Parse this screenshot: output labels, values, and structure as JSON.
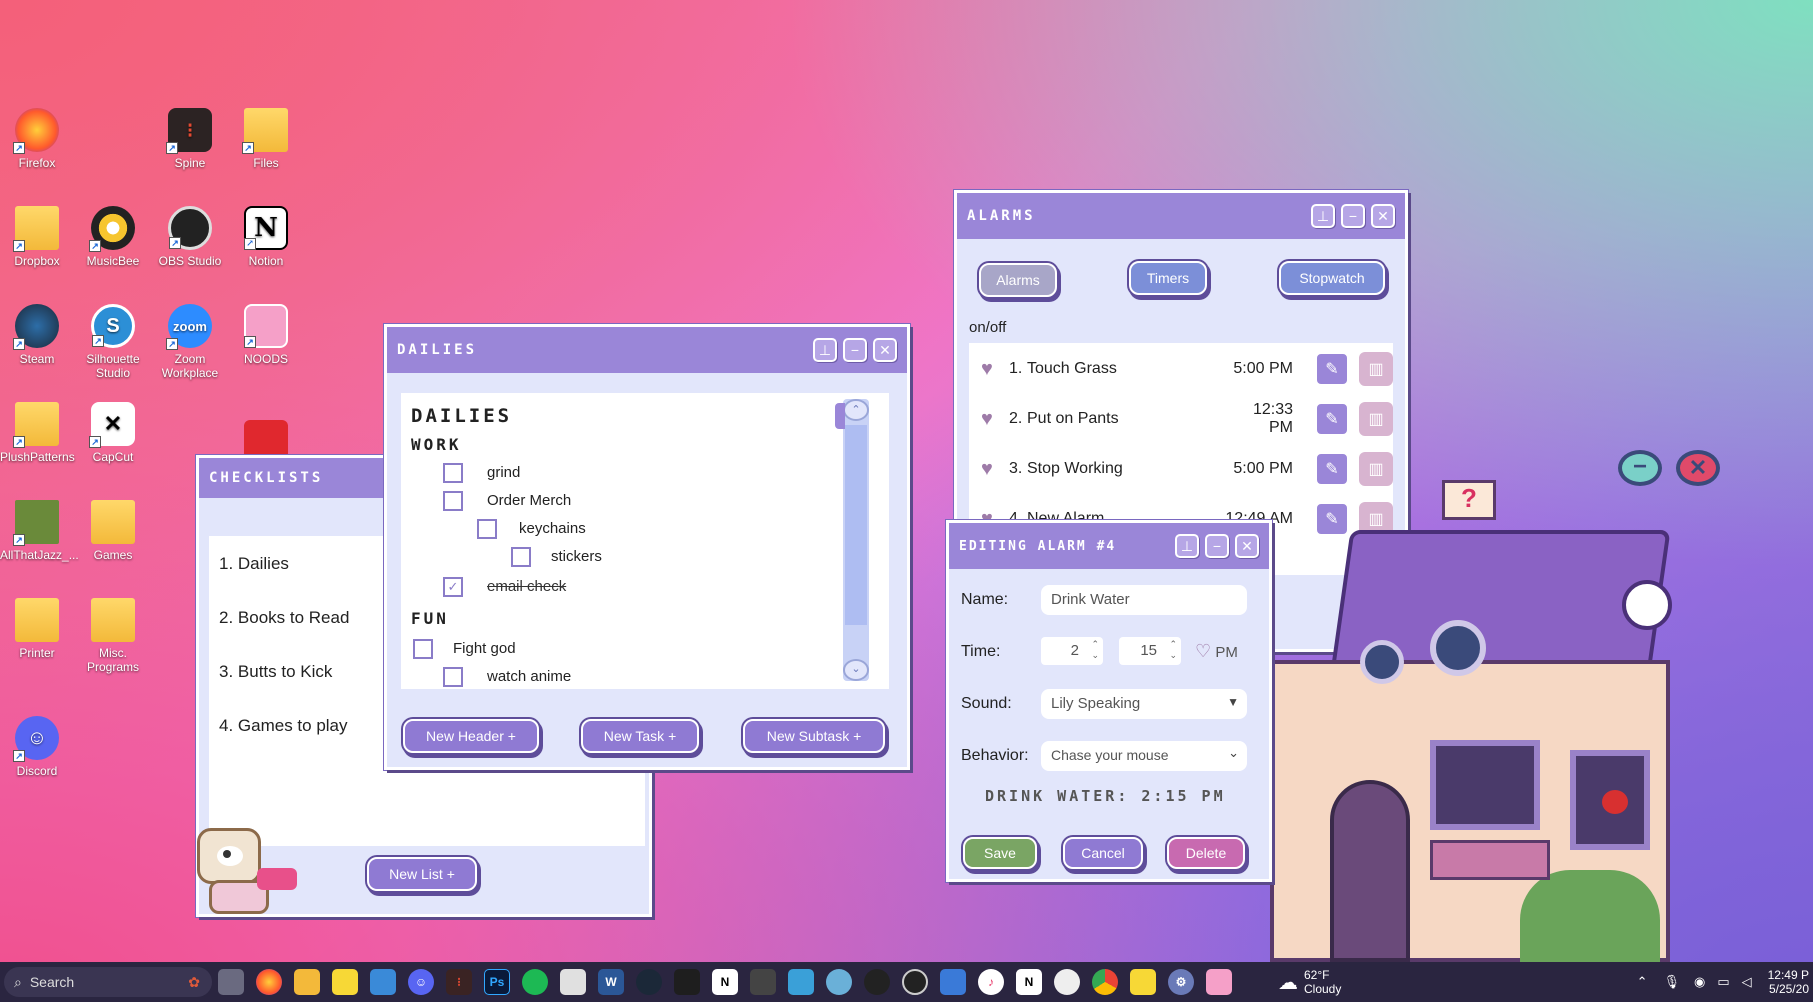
{
  "desktop": {
    "icons": [
      {
        "label": "Firefox",
        "icon": "firefox-icon",
        "color": "#ff7a2f"
      },
      {
        "label": "Spine",
        "icon": "spine-icon",
        "color": "#3a2a2a"
      },
      {
        "label": "Files",
        "icon": "folder-icon",
        "color": "#f3b93a"
      },
      {
        "label": "Dropbox",
        "icon": "folder-icon",
        "color": "#f3b93a"
      },
      {
        "label": "MusicBee",
        "icon": "musicbee-icon",
        "color": "#f7c530"
      },
      {
        "label": "OBS Studio",
        "icon": "obs-icon",
        "color": "#222222"
      },
      {
        "label": "Notion",
        "icon": "notion-icon",
        "color": "#ffffff"
      },
      {
        "label": "Steam",
        "icon": "steam-icon",
        "color": "#1b2838"
      },
      {
        "label": "Silhouette Studio",
        "icon": "silhouette-icon",
        "color": "#2c8fd6"
      },
      {
        "label": "Zoom Workplace",
        "icon": "zoom-icon",
        "color": "#2d8cff"
      },
      {
        "label": "NOODS",
        "icon": "noods-icon",
        "color": "#f5a0c8"
      },
      {
        "label": "PlushPatterns",
        "icon": "folder-icon",
        "color": "#f3b93a"
      },
      {
        "label": "CapCut",
        "icon": "capcut-icon",
        "color": "#ffffff"
      },
      {
        "label": "AllThatJazz_...",
        "icon": "image-icon",
        "color": "#6a8a3a"
      },
      {
        "label": "Games",
        "icon": "folder-icon",
        "color": "#f3b93a"
      },
      {
        "label": "Printer",
        "icon": "folder-icon",
        "color": "#f3b93a"
      },
      {
        "label": "Misc. Programs",
        "icon": "folder-icon",
        "color": "#f3b93a"
      },
      {
        "label": "Discord",
        "icon": "discord-icon",
        "color": "#5865f2"
      }
    ],
    "zoom_text": "zoom",
    "notion_text": "N"
  },
  "checklists_window": {
    "title": "CHECKLISTS",
    "lists": [
      "1. Dailies",
      "2. Books to Read",
      "3. Butts to Kick",
      "4. Games to play"
    ],
    "new_list_label": "New List +"
  },
  "dailies_window": {
    "title": "DAILIES",
    "heading": "DAILIES",
    "sections": [
      {
        "header": "WORK"
      },
      {
        "header": "FUN"
      }
    ],
    "tasks": [
      {
        "label": "grind",
        "checked": false
      },
      {
        "label": "Order Merch",
        "checked": false
      },
      {
        "label": "keychains",
        "checked": false
      },
      {
        "label": "stickers",
        "checked": false
      },
      {
        "label": "email check",
        "checked": true
      },
      {
        "label": "Fight god",
        "checked": false
      },
      {
        "label": "watch anime",
        "checked": false
      }
    ],
    "check_mark": "✓",
    "new_header_label": "New Header +",
    "new_task_label": "New Task +",
    "new_subtask_label": "New Subtask +"
  },
  "alarms_window": {
    "title": "ALARMS",
    "tabs": [
      "Alarms",
      "Timers",
      "Stopwatch"
    ],
    "onoff_label": "on/off",
    "alarms": [
      {
        "num": "1.",
        "name": "Touch Grass",
        "time": "5:00 PM"
      },
      {
        "num": "2.",
        "name": "Put on Pants",
        "time": "12:33 PM"
      },
      {
        "num": "3.",
        "name": "Stop Working",
        "time": "5:00 PM"
      },
      {
        "num": "4.",
        "name": "New Alarm",
        "time": "12:49 AM"
      }
    ]
  },
  "edit_window": {
    "title": "EDITING ALARM #4",
    "name_label": "Name:",
    "name_value": "Drink Water",
    "time_label": "Time:",
    "hour": "2",
    "minute": "15",
    "ampm": "PM",
    "sound_label": "Sound:",
    "sound_value": "Lily Speaking",
    "behavior_label": "Behavior:",
    "behavior_value": "Chase your mouse",
    "summary": "DRINK WATER: 2:15 PM",
    "save_label": "Save",
    "cancel_label": "Cancel",
    "delete_label": "Delete"
  },
  "widget": {
    "sign": "?"
  },
  "taskbar": {
    "search_placeholder": "Search",
    "weather_temp": "62°F",
    "weather_desc": "Cloudy",
    "clock_time": "12:49 P",
    "clock_date": "5/25/20",
    "ps_label": "Ps",
    "w_label": "W",
    "n_label": "N"
  },
  "colors": {
    "accent": "#9a86d8",
    "save": "#7aa564",
    "delete": "#c86ab0"
  }
}
